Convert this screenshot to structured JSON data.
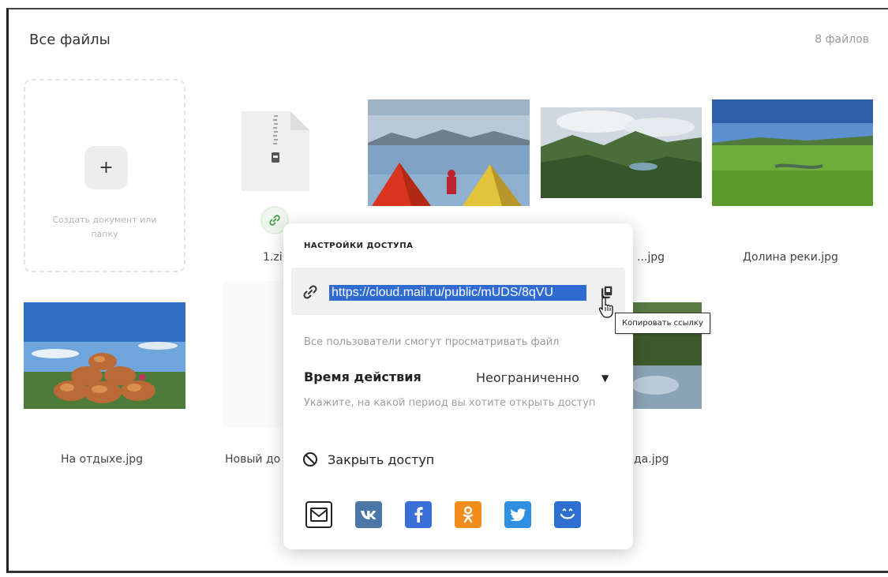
{
  "header": {
    "title": "Все файлы",
    "file_count": "8 файлов"
  },
  "create_tile": {
    "plus": "+",
    "label": "Создать документ или папку"
  },
  "files": {
    "zip_name": "1.zi",
    "photo2_name": "...jpg",
    "photo3_name": "Долина реки.jpg",
    "photo4_name": "На отдыхе.jpg",
    "doc_name": "Новый до",
    "photo5_name": "да.jpg"
  },
  "access_popup": {
    "title": "НАСТРОЙКИ ДОСТУПА",
    "link_url": "https://cloud.mail.ru/public/mUDS/8qVU",
    "copy_tooltip": "Копировать ссылку",
    "view_hint": "Все пользователи смогут просматривать файл",
    "period_label": "Время действия",
    "period_value": "Неограниченно",
    "period_hint": "Укажите, на какой период вы хотите открыть доступ",
    "close_access_label": "Закрыть доступ",
    "share_buttons": [
      {
        "name": "mail",
        "glyph": "✉",
        "color": "#ffffff"
      },
      {
        "name": "vk",
        "glyph": "vk",
        "color": "#4a76a8"
      },
      {
        "name": "facebook",
        "glyph": "f",
        "color": "#3b6fd8"
      },
      {
        "name": "odnoklassniki",
        "glyph": "ok",
        "color": "#f28c1c"
      },
      {
        "name": "twitter",
        "glyph": "tw",
        "color": "#2f8fe0"
      },
      {
        "name": "moimir",
        "glyph": "мм",
        "color": "#2f6fd0"
      }
    ]
  },
  "colors": {
    "accent": "#2f6bd1",
    "link_badge": "#5aa85a"
  }
}
